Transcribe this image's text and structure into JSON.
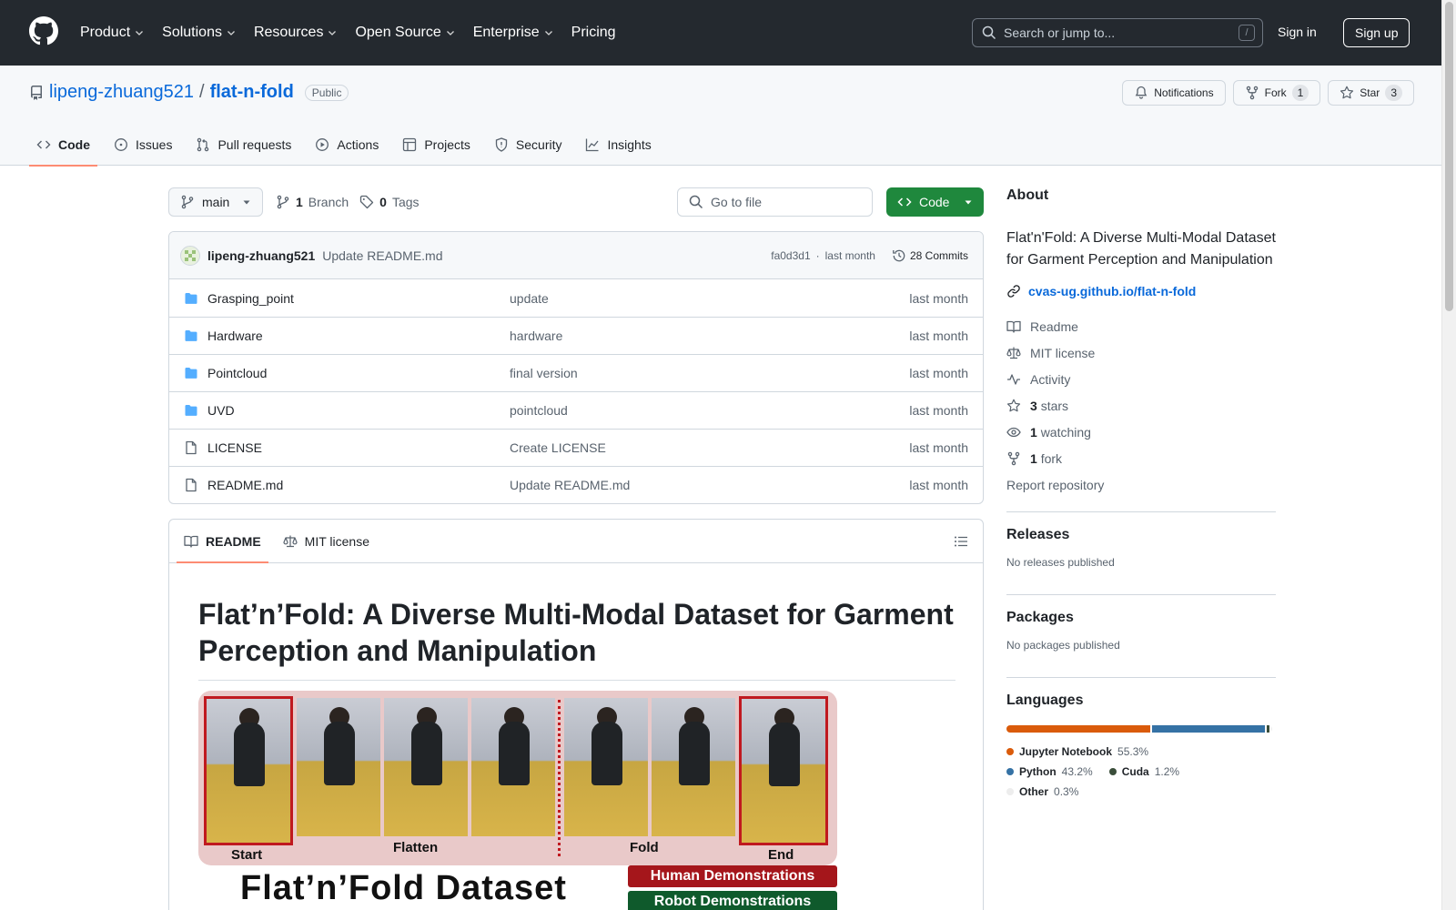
{
  "header": {
    "nav": [
      {
        "label": "Product",
        "dropdown": true
      },
      {
        "label": "Solutions",
        "dropdown": true
      },
      {
        "label": "Resources",
        "dropdown": true
      },
      {
        "label": "Open Source",
        "dropdown": true
      },
      {
        "label": "Enterprise",
        "dropdown": true
      },
      {
        "label": "Pricing",
        "dropdown": false
      }
    ],
    "search_placeholder": "Search or jump to...",
    "search_shortcut": "/",
    "signin": "Sign in",
    "signup": "Sign up"
  },
  "repo": {
    "owner": "lipeng-zhuang521",
    "separator": "/",
    "name": "flat-n-fold",
    "visibility": "Public",
    "notifications": "Notifications",
    "fork_label": "Fork",
    "fork_count": "1",
    "star_label": "Star",
    "star_count": "3",
    "tabs": [
      "Code",
      "Issues",
      "Pull requests",
      "Actions",
      "Projects",
      "Security",
      "Insights"
    ]
  },
  "toolbar": {
    "branch": "main",
    "branch_count": "1",
    "branch_label": "Branch",
    "tag_count": "0",
    "tag_label": "Tags",
    "goto_placeholder": "Go to file",
    "code_button": "Code"
  },
  "commit": {
    "author": "lipeng-zhuang521",
    "message": "Update README.md",
    "hash": "fa0d3d1",
    "sep": "·",
    "age": "last month",
    "count_label": "28 Commits"
  },
  "files": [
    {
      "type": "dir",
      "name": "Grasping_point",
      "message": "update",
      "age": "last month"
    },
    {
      "type": "dir",
      "name": "Hardware",
      "message": "hardware",
      "age": "last month"
    },
    {
      "type": "dir",
      "name": "Pointcloud",
      "message": "final version",
      "age": "last month"
    },
    {
      "type": "dir",
      "name": "UVD",
      "message": "pointcloud",
      "age": "last month"
    },
    {
      "type": "file",
      "name": "LICENSE",
      "message": "Create LICENSE",
      "age": "last month"
    },
    {
      "type": "file",
      "name": "README.md",
      "message": "Update README.md",
      "age": "last month"
    }
  ],
  "readme": {
    "tab_readme": "README",
    "tab_license": "MIT license",
    "title": "Flat’n’Fold: A Diverse Multi-Modal Dataset for Garment Perception and Manipulation",
    "figure": {
      "label_start": "Start",
      "label_flatten": "Flatten",
      "label_fold": "Fold",
      "label_end": "End",
      "dataset_title": "Flat’n’Fold Dataset",
      "human_demo": "Human Demonstrations",
      "robot_demo": "Robot Demonstrations",
      "human_color": "#a5161b",
      "robot_color": "#0f5a2c"
    }
  },
  "about": {
    "heading": "About",
    "description": "Flat'n'Fold: A Diverse Multi-Modal Dataset for Garment Perception and Manipulation",
    "link": "cvas-ug.github.io/flat-n-fold",
    "readme": "Readme",
    "license": "MIT license",
    "activity": "Activity",
    "stars_count": "3",
    "stars_label": "stars",
    "watching_count": "1",
    "watching_label": "watching",
    "forks_count": "1",
    "forks_label": "fork",
    "report": "Report repository"
  },
  "releases": {
    "heading": "Releases",
    "empty": "No releases published"
  },
  "packages": {
    "heading": "Packages",
    "empty": "No packages published"
  },
  "languages": {
    "heading": "Languages",
    "items": [
      {
        "name": "Jupyter Notebook",
        "percent": "55.3%",
        "value": 55.3,
        "color": "#da5b0b"
      },
      {
        "name": "Python",
        "percent": "43.2%",
        "value": 43.2,
        "color": "#3572a5"
      },
      {
        "name": "Cuda",
        "percent": "1.2%",
        "value": 1.2,
        "color": "#3a4e3a"
      },
      {
        "name": "Other",
        "percent": "0.3%",
        "value": 0.3,
        "color": "#ededed"
      }
    ]
  },
  "colors": {
    "header_bg": "#24292f",
    "accent_link": "#0969da",
    "code_button": "#1f883d",
    "active_tab_underline": "#fd8c73"
  }
}
